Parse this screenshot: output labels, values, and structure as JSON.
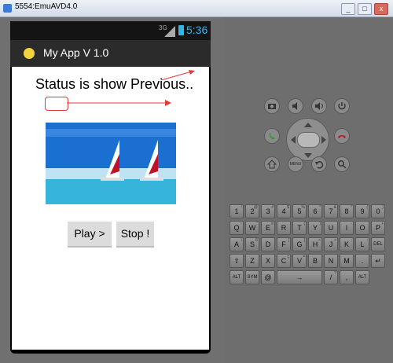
{
  "window": {
    "title": "5554:EmuAVD4.0",
    "controls": [
      "_",
      "□",
      "x"
    ]
  },
  "status_bar": {
    "network": "3G",
    "time": "5:36"
  },
  "action_bar": {
    "icon": "clock-app-icon",
    "title": "My App V 1.0"
  },
  "content": {
    "status_text": "Status is show Previous..",
    "text_field_value": "",
    "image": "sailboats-photo",
    "buttons": {
      "play": "Play >",
      "stop": "Stop !"
    }
  },
  "controls": {
    "buttons": [
      "camera-icon",
      "volume-down-icon",
      "volume-up-icon",
      "power-icon",
      "call-icon",
      "end-call-icon",
      "home-icon",
      "menu-icon",
      "back-icon",
      "search-icon"
    ],
    "menu_label": "MENU"
  },
  "keyboard": {
    "rows": [
      [
        [
          "1",
          "!"
        ],
        [
          "2",
          "@"
        ],
        [
          "3",
          "#"
        ],
        [
          "4",
          "$"
        ],
        [
          "5",
          "%"
        ],
        [
          "6",
          "^"
        ],
        [
          "7",
          "&"
        ],
        [
          "8",
          "*"
        ],
        [
          "9",
          "("
        ],
        [
          "0",
          ")"
        ]
      ],
      [
        [
          "Q",
          "~"
        ],
        [
          "W",
          "\""
        ],
        [
          "E",
          "é"
        ],
        [
          "R",
          ""
        ],
        [
          "T",
          "{"
        ],
        [
          "Y",
          "}"
        ],
        [
          "U",
          ""
        ],
        [
          "I",
          "-"
        ],
        [
          "O",
          ""
        ],
        [
          "P",
          "+"
        ]
      ],
      [
        [
          "A",
          "\\"
        ],
        [
          "S",
          "ß"
        ],
        [
          "D",
          ""
        ],
        [
          "F",
          "["
        ],
        [
          "G",
          "]"
        ],
        [
          "H",
          "<"
        ],
        [
          "J",
          ">"
        ],
        [
          "K",
          ";"
        ],
        [
          "L",
          ":"
        ],
        [
          "DEL",
          ""
        ]
      ],
      [
        [
          "⇧",
          ""
        ],
        [
          "Z",
          ""
        ],
        [
          "X",
          ""
        ],
        [
          "C",
          "ç"
        ],
        [
          "V",
          "="
        ],
        [
          "B",
          ""
        ],
        [
          "N",
          ""
        ],
        [
          "M",
          ""
        ],
        [
          ".",
          ""
        ],
        [
          "↵",
          ""
        ]
      ],
      [
        [
          "ALT",
          ""
        ],
        [
          "SYM",
          ""
        ],
        [
          "@",
          ""
        ],
        [
          "→",
          ""
        ],
        [
          "/",
          "?"
        ],
        [
          ",",
          ""
        ],
        [
          "ALT",
          ""
        ]
      ]
    ]
  }
}
